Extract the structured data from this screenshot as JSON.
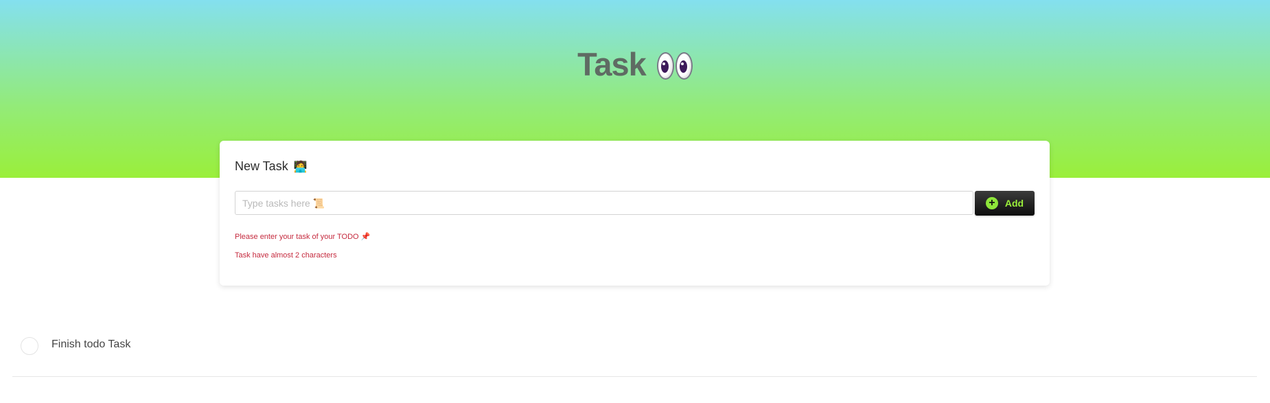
{
  "header": {
    "title": "Task",
    "title_icon": "eyes-emoji"
  },
  "new_task": {
    "title": "New Task",
    "title_emoji": "🧑‍💻",
    "input": {
      "value": "",
      "placeholder": "Type tasks here 📜"
    },
    "add_button": {
      "label": "Add",
      "icon": "plus-circle-icon"
    },
    "errors": [
      "Please enter your task of your TODO 📌",
      "Task have almost 2 characters"
    ]
  },
  "todos": [
    {
      "label": "Finish todo Task",
      "done": false
    }
  ],
  "colors": {
    "gradient_top": "#84e0ef",
    "gradient_bottom": "#9aef3a",
    "accent_green": "#9aef3a",
    "error_red": "#c52a3e",
    "button_dark": "#0e0e0e"
  }
}
